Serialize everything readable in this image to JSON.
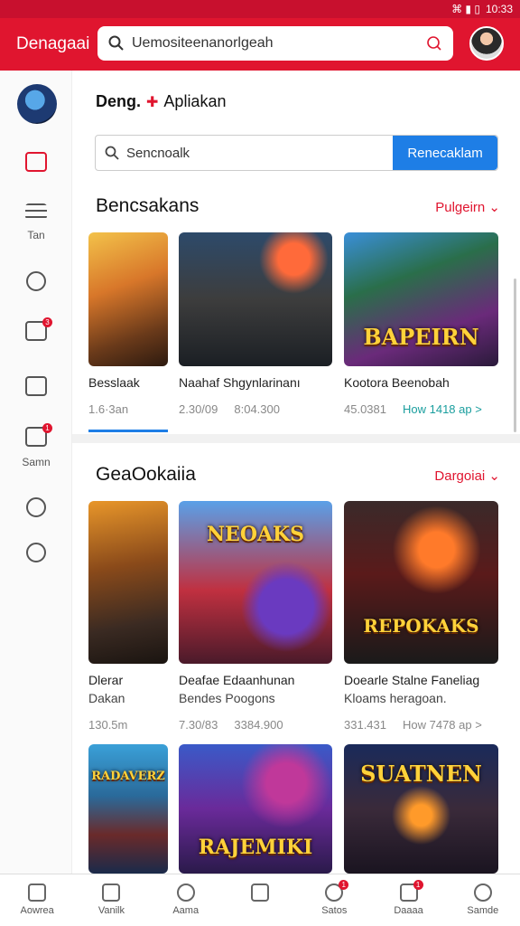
{
  "status": {
    "time": "10:33",
    "icons": "⌘ ▮ ▯"
  },
  "header": {
    "title": "Denagaai",
    "search_text": "Uemositeenanorlgeah"
  },
  "sidebar": {
    "items": [
      {
        "label": "",
        "icon": "message-icon",
        "badge": ""
      },
      {
        "label": "Tan",
        "icon": "list-icon",
        "badge": ""
      },
      {
        "label": "",
        "icon": "clock-icon",
        "badge": ""
      },
      {
        "label": "",
        "icon": "chart-icon",
        "badge": "3"
      },
      {
        "label": "",
        "icon": "calendar-icon",
        "badge": ""
      },
      {
        "label": "Samn",
        "icon": "video-icon",
        "badge": "1"
      },
      {
        "label": "",
        "icon": "compass-icon",
        "badge": ""
      },
      {
        "label": "",
        "icon": "info-icon",
        "badge": ""
      }
    ]
  },
  "main": {
    "heading_left": "Deng.",
    "heading_right": "Apliakan",
    "search_placeholder": "Sencnoalk",
    "search_button": "Renecaklam",
    "section1": {
      "title": "Bencsakans",
      "more": "Pulgeirn ⌄",
      "cards": [
        {
          "title": "Besslaak",
          "sub": "",
          "meta1": "1.6·3an",
          "meta2": "",
          "art": ""
        },
        {
          "title": "Naahaf Shgynlarinanı",
          "sub": "",
          "meta1": "2.30/09",
          "meta2": "8:04.300",
          "art": ""
        },
        {
          "title": "Kootora Beenobah",
          "sub": "",
          "meta1": "45.0381",
          "meta2": "How  1418 ap  >",
          "art": "BAPEIRN"
        }
      ]
    },
    "section2": {
      "title": "GeaOokaiia",
      "more": "Dargoiai ⌄",
      "cards": [
        {
          "title": "Dlerar",
          "sub": "Dakan",
          "meta1": "130.5m",
          "meta2": "",
          "art": ""
        },
        {
          "title": "Deafae  Edaanhunan",
          "sub": "Bendes Poogons",
          "meta1": "7.30/83",
          "meta2": "3384.900",
          "art": "NEOAKS"
        },
        {
          "title": "Doearle  Stalne Faneliag",
          "sub": "Kloams heragoan.",
          "meta1": "331.431",
          "meta2": "How  7478 ap  >",
          "art": "REPOKAKS"
        }
      ]
    },
    "section3": {
      "cards": [
        {
          "art": "RADAVERZ"
        },
        {
          "art": "RAJEMIKI"
        },
        {
          "art": "SUATNEN"
        }
      ]
    }
  },
  "bottom_nav": [
    {
      "label": "Aowrea",
      "icon": "home-icon",
      "badge": ""
    },
    {
      "label": "Vanilk",
      "icon": "bookmark-icon",
      "badge": ""
    },
    {
      "label": "Aama",
      "icon": "search-icon",
      "badge": ""
    },
    {
      "label": "",
      "icon": "download-icon",
      "badge": ""
    },
    {
      "label": "Satos",
      "icon": "gift-icon",
      "badge": "1"
    },
    {
      "label": "Daaaa",
      "icon": "inbox-icon",
      "badge": "1"
    },
    {
      "label": "Samde",
      "icon": "profile-icon",
      "badge": ""
    }
  ]
}
